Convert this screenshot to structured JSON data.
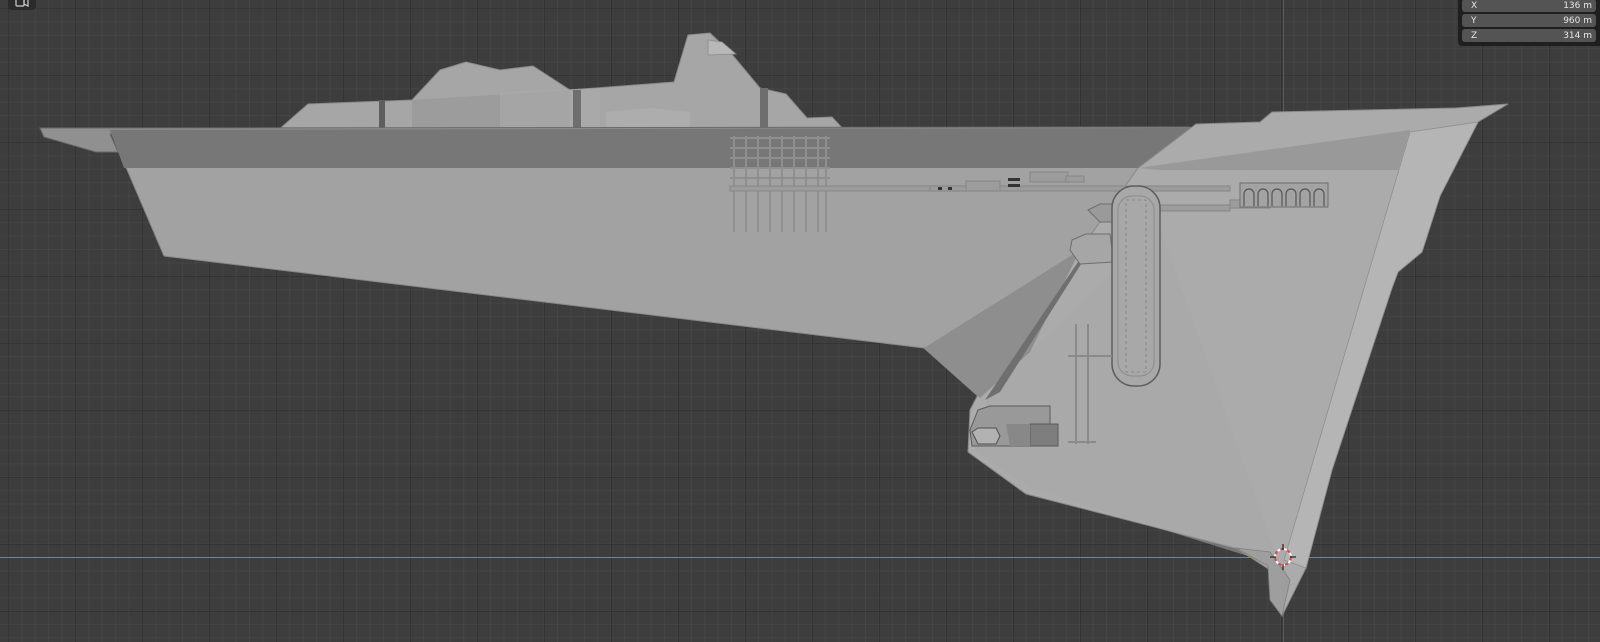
{
  "viewport": {
    "view_mode_icon": "camera-view-icon",
    "axis_colors": {
      "x_axis": "#6f9b2c",
      "z_axis": "#2f63a8"
    },
    "background": "#3d3d3d",
    "model_color": "#a3a3a3"
  },
  "dimensions_panel": {
    "rows": [
      {
        "label": "X",
        "value": "136 m"
      },
      {
        "label": "Y",
        "value": "960 m"
      },
      {
        "label": "Z",
        "value": "314 m"
      }
    ]
  },
  "cursor_icon": "3d-cursor-icon"
}
